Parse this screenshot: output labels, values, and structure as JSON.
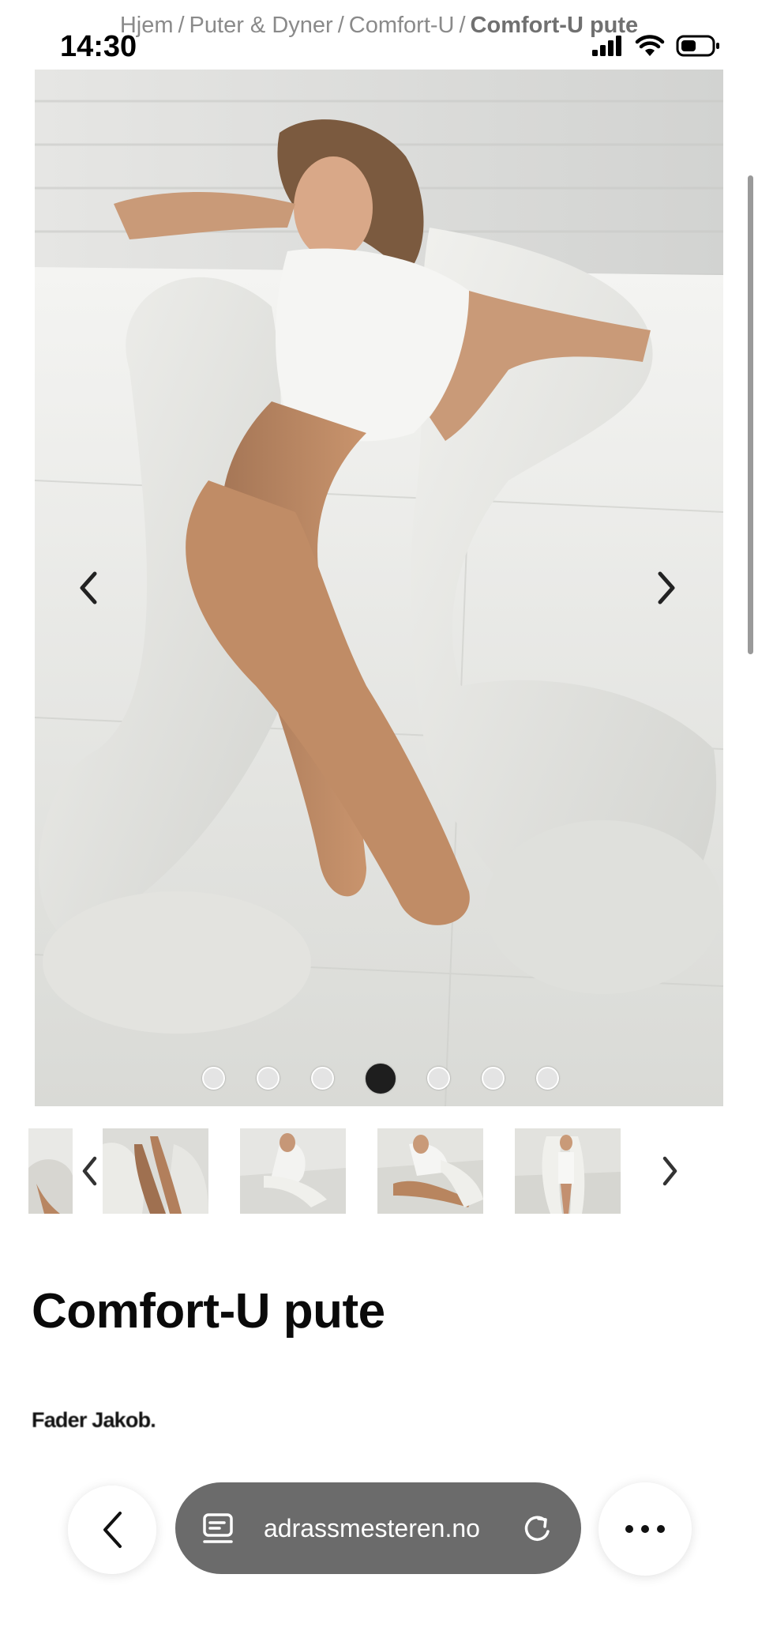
{
  "status_bar": {
    "time": "14:30"
  },
  "breadcrumb": {
    "items": [
      "Hjem",
      "Puter & Dyner",
      "Comfort-U"
    ],
    "separator": "/",
    "current": "Comfort-U pute"
  },
  "gallery": {
    "dot_count": 7,
    "active_index": 3,
    "thumbnail_count": 5
  },
  "product": {
    "title": "Comfort-U pute",
    "brand": "Fader Jakob."
  },
  "browser": {
    "url": "adrassmesteren.no"
  },
  "icons": {
    "prev": "chevron-left-icon",
    "next": "chevron-right-icon",
    "back": "back-arrow-icon",
    "tabs": "tabs-icon",
    "reload": "reload-icon",
    "more": "more-icon"
  }
}
